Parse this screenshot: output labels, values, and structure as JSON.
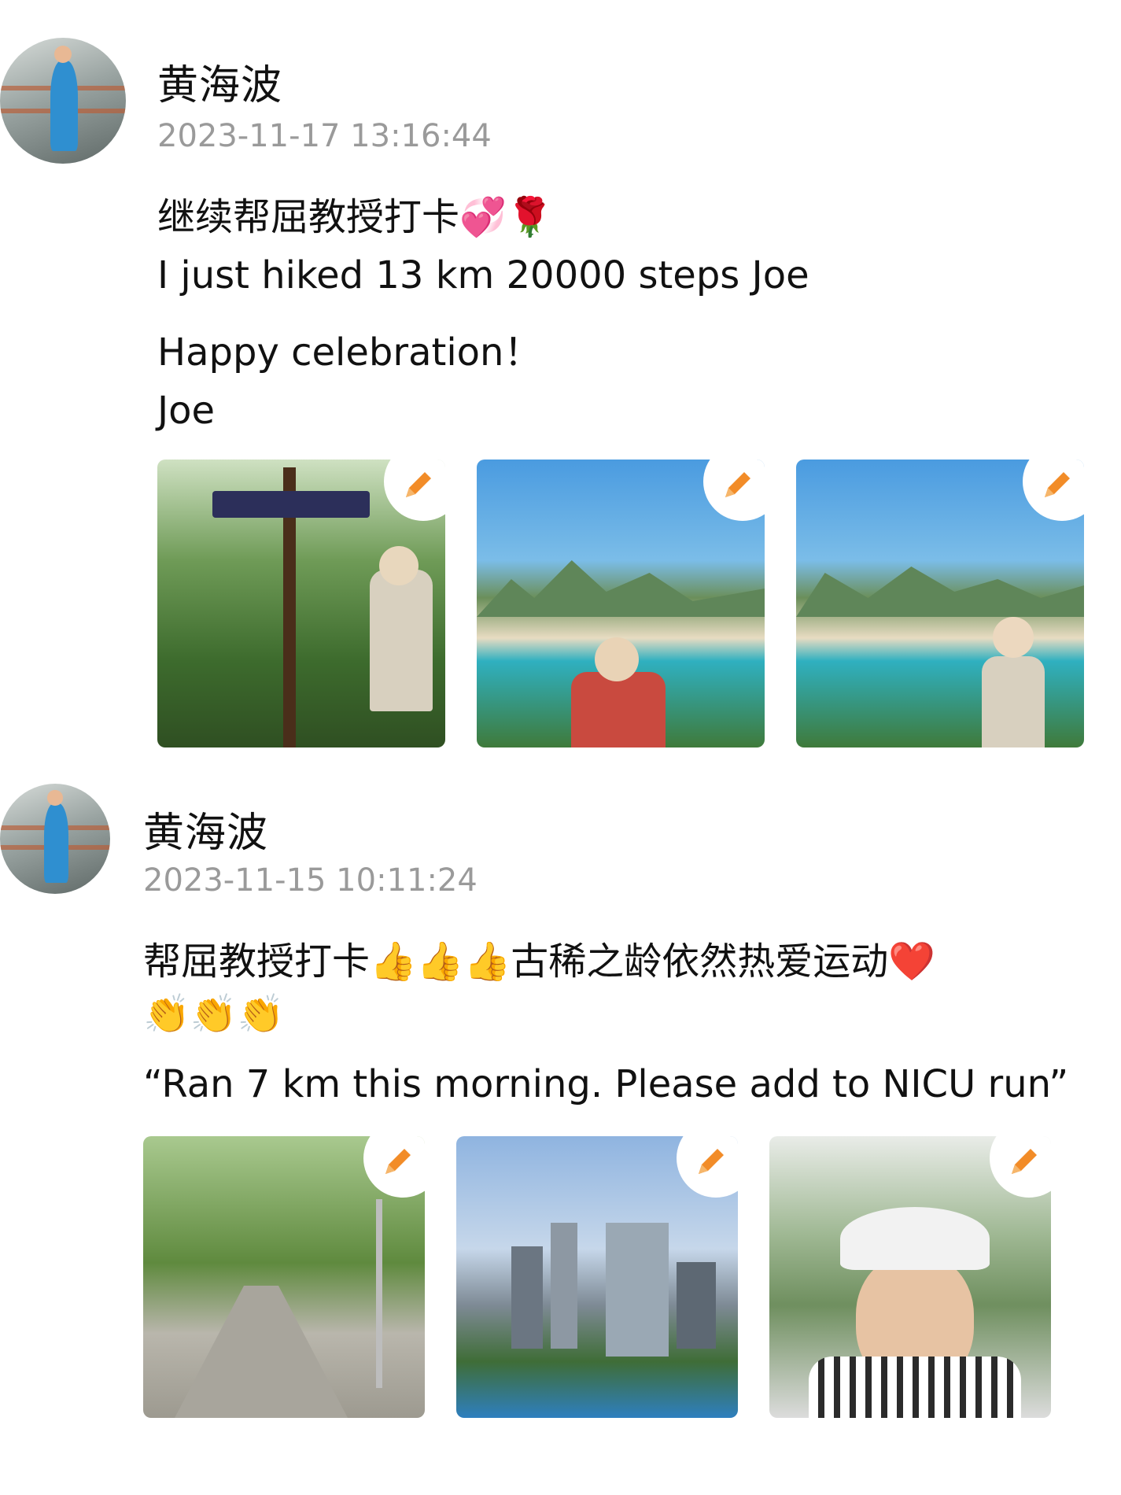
{
  "posts": [
    {
      "author": "黄海波",
      "timestamp": "2023-11-17 13:16:44",
      "lines": [
        "继续帮屈教授打卡💞🌹",
        "I just hiked 13 km 20000 steps Joe",
        "Happy celebration！",
        "Joe"
      ],
      "photos": [
        "trail-sign-hiker",
        "beach-bay-hiker",
        "beach-bay-hiker-2"
      ],
      "edit_icon": "pencil-icon"
    },
    {
      "author": "黄海波",
      "timestamp": "2023-11-15 10:11:24",
      "lines": [
        "帮屈教授打卡👍👍👍古稀之龄依然热爱运动❤️",
        "👏👏👏",
        "“Ran 7 km this morning. Please add to NICU run”"
      ],
      "photos": [
        "forest-path",
        "city-skyline",
        "selfie-man-cap"
      ],
      "edit_icon": "pencil-icon"
    }
  ],
  "colors": {
    "accent_orange": "#F28C28",
    "timestamp_gray": "#9A9A9A"
  }
}
